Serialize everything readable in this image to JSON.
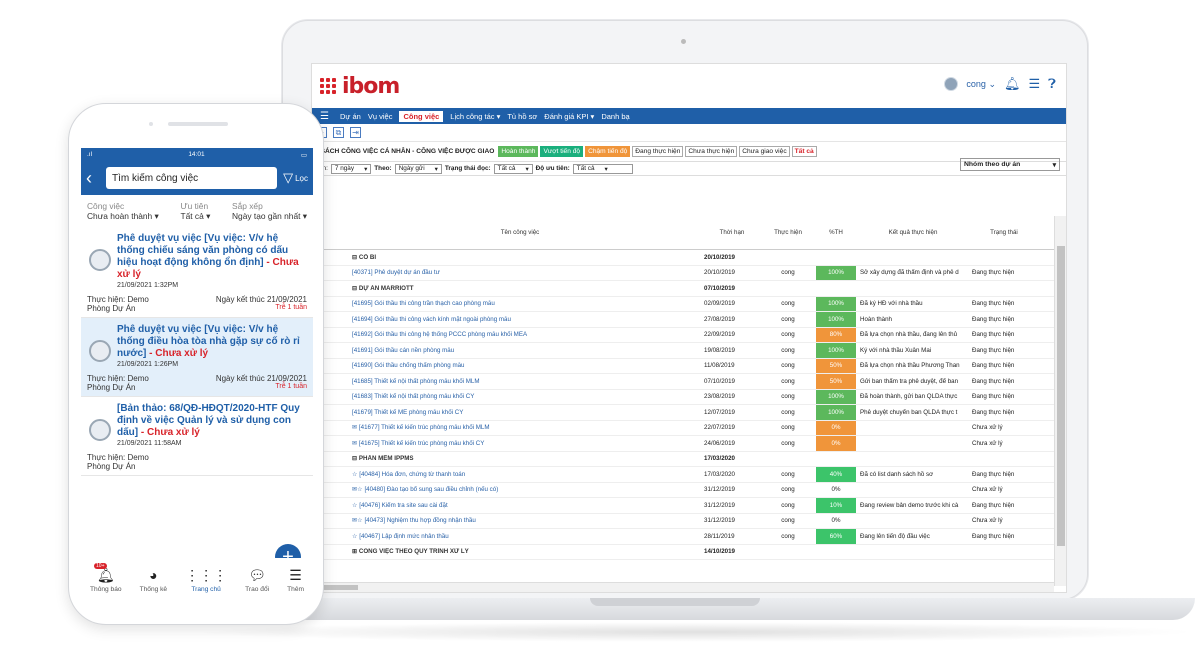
{
  "laptop": {
    "logo": "ibom",
    "user": "cong",
    "nav": [
      "Dự án",
      "Vụ việc",
      "Công việc",
      "Lịch công tác ▾",
      "Tủ hồ sơ",
      "Đánh giá KPI ▾",
      "Danh bạ"
    ],
    "nav_active_index": 2,
    "list_title": "H SÁCH CÔNG VIỆC CÁ NHÂN - CÔNG VIỆC ĐƯỢC GIAO",
    "status_chips": [
      {
        "label": "Hoàn thành",
        "style": "green"
      },
      {
        "label": "Vượt tiến độ",
        "style": "teal"
      },
      {
        "label": "Chậm tiến độ",
        "style": "orange"
      },
      {
        "label": "Đang thực hiện",
        "style": "plain"
      },
      {
        "label": "Chưa thực hiện",
        "style": "plain"
      },
      {
        "label": "Chưa giao việc",
        "style": "plain"
      },
      {
        "label": "Tất cả",
        "style": "red"
      }
    ],
    "group_select": "Nhóm theo dự án",
    "filters": {
      "period_label": "gian:",
      "period_value": "7 ngày",
      "by_label": "Theo:",
      "by_value": "Ngày gửi",
      "read_label": "Trạng thái đọc:",
      "read_value": "Tất cả",
      "priority_label": "Độ ưu tiên:",
      "priority_value": "Tất cả"
    },
    "columns": [
      "T",
      "Tên công việc",
      "Thời hạn",
      "Thực hiện",
      "%TH",
      "Kết quả thực hiện",
      "Trạng thái"
    ],
    "rows": [
      {
        "type": "group",
        "name": "⊟ CỔ BI",
        "deadline": "20/10/2019"
      },
      {
        "type": "item",
        "name": "[40371] Phê duyệt dự án đầu tư",
        "deadline": "20/10/2019",
        "assignee": "cong",
        "pct": "100%",
        "pct_style": "green",
        "result": "Sở xây dựng đã thẩm định và phê d",
        "status": "Đang thực hiện"
      },
      {
        "type": "group",
        "name": "⊟ DỰ ÁN MARRIOTT",
        "deadline": "07/10/2019"
      },
      {
        "type": "item",
        "name": "[41695] Gói thầu thi công trần thạch cao phòng mẫu",
        "deadline": "02/09/2019",
        "assignee": "cong",
        "pct": "100%",
        "pct_style": "green",
        "result": "Đã ký HĐ với nhà thầu",
        "status": "Đang thực hiện"
      },
      {
        "type": "item",
        "name": "[41694] Gói thầu thi công vách kính mặt ngoài phòng mẫu",
        "deadline": "27/08/2019",
        "assignee": "cong",
        "pct": "100%",
        "pct_style": "green",
        "result": "Hoàn thành",
        "status": "Đang thực hiện"
      },
      {
        "type": "item",
        "name": "[41692] Gói thầu thi công hệ thống PCCC phòng mẫu khối MEA",
        "deadline": "22/09/2019",
        "assignee": "cong",
        "pct": "80%",
        "pct_style": "orange",
        "result": "Đã lựa chọn nhà thầu, đang lên thủ",
        "status": "Đang thực hiện"
      },
      {
        "type": "item",
        "name": "[41691] Gói thầu cán nền phòng mẫu",
        "deadline": "19/08/2019",
        "assignee": "cong",
        "pct": "100%",
        "pct_style": "green",
        "result": "Ký với nhà thầu Xuân Mai",
        "status": "Đang thực hiện"
      },
      {
        "type": "item",
        "name": "[41690] Gói thầu chống thấm phòng mẫu",
        "deadline": "11/08/2019",
        "assignee": "cong",
        "pct": "50%",
        "pct_style": "orange",
        "result": "Đã lựa chọn nhà thầu Phương Than",
        "status": "Đang thực hiện"
      },
      {
        "type": "item",
        "name": "[41685] Thiết kế nội thất phòng mẫu khối MLM",
        "deadline": "07/10/2019",
        "assignee": "cong",
        "pct": "50%",
        "pct_style": "orange",
        "result": "Gửi ban thẩm tra phê duyệt, để ban",
        "status": "Đang thực hiện"
      },
      {
        "type": "item",
        "name": "[41683] Thiết kế nội thất phòng mẫu khối CY",
        "deadline": "23/08/2019",
        "assignee": "cong",
        "pct": "100%",
        "pct_style": "green",
        "result": "Đã hoàn thành, gửi ban QLDA thực",
        "status": "Đang thực hiện"
      },
      {
        "type": "item",
        "name": "[41679] Thiết kế ME phòng mẫu khối CY",
        "deadline": "12/07/2019",
        "assignee": "cong",
        "pct": "100%",
        "pct_style": "green",
        "result": "Phê duyệt chuyển ban QLDA thực t",
        "status": "Đang thực hiện"
      },
      {
        "type": "item",
        "name": "✉ [41677] Thiết kế kiến trúc phòng mẫu khối MLM",
        "deadline": "22/07/2019",
        "assignee": "cong",
        "pct": "0%",
        "pct_style": "orange",
        "result": "",
        "status": "Chưa xử lý"
      },
      {
        "type": "item",
        "prefix": "0",
        "name": "✉ [41675] Thiết kế kiến trúc phòng mẫu khối CY",
        "deadline": "24/06/2019",
        "assignee": "cong",
        "pct": "0%",
        "pct_style": "orange",
        "result": "",
        "status": "Chưa xử lý"
      },
      {
        "type": "group",
        "name": "⊟ PHẦN MỀM IPPMS",
        "deadline": "17/03/2020"
      },
      {
        "type": "item",
        "name": "☆ [40484] Hóa đơn, chứng từ thanh toán",
        "deadline": "17/03/2020",
        "assignee": "cong",
        "pct": "40%",
        "pct_style": "green2",
        "result": "Đã có list danh sách hồ sơ",
        "status": "Đang thực hiện"
      },
      {
        "type": "item",
        "name": "✉☆ [40480] Đào tạo bổ sung sau điều chỉnh (nếu có)",
        "deadline": "31/12/2019",
        "assignee": "cong",
        "pct": "0%",
        "pct_style": "none",
        "result": "",
        "status": "Chưa xử lý"
      },
      {
        "type": "item",
        "name": "☆ [40476] Kiểm tra site sau cài đặt",
        "deadline": "31/12/2019",
        "assignee": "cong",
        "pct": "10%",
        "pct_style": "green2",
        "result": "Đang review bản demo trước khi cà",
        "status": "Đang thực hiện"
      },
      {
        "type": "item",
        "name": "✉☆ [40473] Nghiệm thu hợp đồng nhận thầu",
        "deadline": "31/12/2019",
        "assignee": "cong",
        "pct": "0%",
        "pct_style": "none",
        "result": "",
        "status": "Chưa xử lý"
      },
      {
        "type": "item",
        "name": "☆ [40467] Lập định mức nhân thầu",
        "deadline": "28/11/2019",
        "assignee": "cong",
        "pct": "60%",
        "pct_style": "green2",
        "result": "Đang lên tiến độ đầu việc",
        "status": "Đang thực hiện"
      },
      {
        "type": "group",
        "name": "⊞ CÔNG VIỆC THEO QUY TRÌNH XỬ LÝ",
        "deadline": "14/10/2019"
      }
    ]
  },
  "phone": {
    "time": "14:01",
    "search_placeholder": "Tìm kiếm công việc",
    "filter_button": "Lọc",
    "filters": [
      {
        "label": "Công việc",
        "value": "Chưa hoàn thành ▾"
      },
      {
        "label": "Ưu tiên",
        "value": "Tất cả ▾"
      },
      {
        "label": "Sắp xếp",
        "value": "Ngày tạo gần nhất ▾"
      }
    ],
    "cards": [
      {
        "title": "Phê duyệt vụ việc [Vụ việc: V/v hệ thống chiếu sáng văn phòng có dấu hiệu hoạt động không ổn định]",
        "status": " - Chưa xử lý",
        "time": "21/09/2021  1:32PM",
        "performer": "Thực hiện: Demo",
        "end": "Ngày kết thúc 21/09/2021",
        "dept": "Phòng Dự Án",
        "late": "Trễ 1 tuần"
      },
      {
        "title": "Phê duyệt vụ việc [Vụ việc: V/v hệ thống điều hòa tòa nhà gặp sự cố rò rỉ nước]",
        "status": " - Chưa xử lý",
        "time": "21/09/2021  1:26PM",
        "performer": "Thực hiện: Demo",
        "end": "Ngày kết thúc 21/09/2021",
        "dept": "Phòng Dự Án",
        "late": "Trễ 1 tuần"
      },
      {
        "title": "[Bản thảo: 68/QĐ-HĐQT/2020-HTF Quy định về việc Quản lý và sử dụng con dấu]",
        "status": " - Chưa xử lý",
        "time": "21/09/2021  11:58AM",
        "performer": "Thực hiện: Demo",
        "end": "",
        "dept": "Phòng Dự Án",
        "late": ""
      }
    ],
    "badge": "10+",
    "tabs": [
      "Thông báo",
      "Thống kê",
      "Trang chủ",
      "Trao đổi",
      "Thêm"
    ],
    "active_tab": 2
  }
}
